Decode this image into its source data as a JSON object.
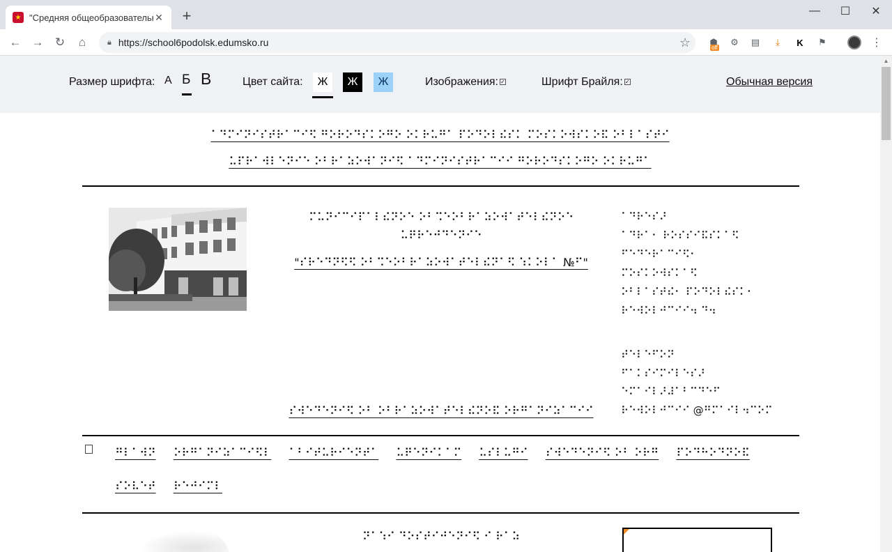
{
  "browser": {
    "tab_title": "\"Средняя общеобразовательна",
    "tab_close": "✕",
    "new_tab": "+",
    "window_minimize": "—",
    "window_maximize": "☐",
    "window_close": "✕",
    "url": "https://school6podolsk.edumsko.ru",
    "ext_off_badge": "off",
    "ext_k_label": "K"
  },
  "accessibility_panel": {
    "font_size_label": "Размер шрифта:",
    "font_sizes": [
      "А",
      "Б",
      "В"
    ],
    "site_color_label": "Цвет сайта:",
    "color_options": [
      {
        "label": "Ж",
        "bg": "#ffffff",
        "fg": "#000000"
      },
      {
        "label": "Ж",
        "bg": "#000000",
        "fg": "#ffffff"
      },
      {
        "label": "Ж",
        "bg": "#9dd1f8",
        "fg": "#063462"
      }
    ],
    "images_label": "Изображения:",
    "braille_label": "Шрифт Брайля:",
    "normal_version_link": "Обычная версия"
  },
  "header": {
    "title_line1": "⠁⠙⠍⠊⠝⠊⠎⠞⠗⠁⠉⠊⠫ ⠛⠕⠗⠕⠙⠎⠅⠕⠛⠕ ⠕⠅⠗⠥⠛⠁ ⠏⠕⠙⠕⠇⠮⠎⠅ ⠍⠕⠎⠅⠕⠺⠎⠅⠕⠯ ⠕⠃⠇⠁⠎⠞⠊",
    "title_line2": "⠥⠏⠗⠁⠺⠇⠑⠝⠊⠑ ⠕⠃⠗⠁⠵⠕⠺⠁⠝⠊⠫ ⠁⠙⠍⠊⠝⠊⠎⠞⠗⠁⠉⠊⠊ ⠛⠕⠗⠕⠙⠎⠅⠕⠛⠕ ⠕⠅⠗⠥⠛⠁"
  },
  "school": {
    "name_line1": "⠍⠥⠝⠊⠉⠊⠏⠁⠇⠮⠝⠕⠑ ⠕⠃⠩⠑⠕⠃⠗⠁⠵⠕⠺⠁⠞⠑⠇⠮⠝⠕⠑",
    "name_line2": "⠥⠟⠗⠑⠚⠙⠑⠝⠊⠑",
    "name_link": "\"⠎⠗⠑⠙⠝⠫⠫ ⠕⠃⠩⠑⠕⠃⠗⠁⠵⠕⠺⠁⠞⠑⠇⠮⠝⠁⠫ ⠱⠅⠕⠇⠁ №⠋\"",
    "sveden_link": "⠎⠺⠑⠙⠑⠝⠊⠫ ⠕⠃ ⠕⠃⠗⠁⠵⠕⠺⠁⠞⠑⠇⠮⠝⠕⠯ ⠕⠗⠛⠁⠝⠊⠵⠁⠉⠊⠊"
  },
  "address": {
    "lines_a": [
      "⠁⠙⠗⠑⠎⠜",
      "⠁⠙⠗⠁⠂ ⠗⠕⠎⠎⠊⠯⠎⠅⠁⠫",
      "⠋⠑⠙⠑⠗⠁⠉⠊⠫⠂",
      "⠍⠕⠎⠅⠕⠺⠎⠅⠁⠫",
      "⠕⠃⠇⠁⠎⠞⠮⠂ ⠏⠕⠙⠕⠇⠮⠎⠅⠂",
      "⠗⠑⠺⠕⠇⠚⠉⠊⠊⠲ ⠙⠲"
    ],
    "lines_b": [
      "⠞⠑⠇⠑⠋⠕⠝",
      "⠋⠁⠅⠎⠊⠍⠊⠇⠑⠎⠜",
      "⠑⠍⠁⠊⠇⠜⠼⠁⠃⠉⠙⠑⠋",
      "⠗⠑⠺⠕⠇⠚⠉⠊⠊ @⠛⠍⠁⠊⠇⠲⠉⠕⠍"
    ]
  },
  "menu": {
    "items_row1": [
      "⠛⠇⠁⠺⠝",
      "⠕⠗⠛⠁⠝⠊⠵⠁⠉⠊⠫⠇",
      "⠁⠃⠊⠞⠥⠗⠊⠑⠝⠞⠁",
      "⠥⠟⠑⠝⠊⠅⠁⠍",
      "⠥⠎⠇⠥⠛⠊",
      "⠎⠺⠑⠙⠑⠝⠊⠫ ⠕⠃ ⠕⠗⠛",
      "⠏⠕⠙⠓⠕⠙⠝⠕⠯"
    ],
    "items_row2": [
      "⠎⠕⠧⠑⠞",
      "⠗⠑⠚⠊⠍⠇"
    ]
  },
  "news": {
    "heading": "⠝⠁⠱⠊ ⠙⠕⠎⠞⠊⠚⠑⠝⠊⠫ ⠊ ⠗⠁⠵"
  }
}
